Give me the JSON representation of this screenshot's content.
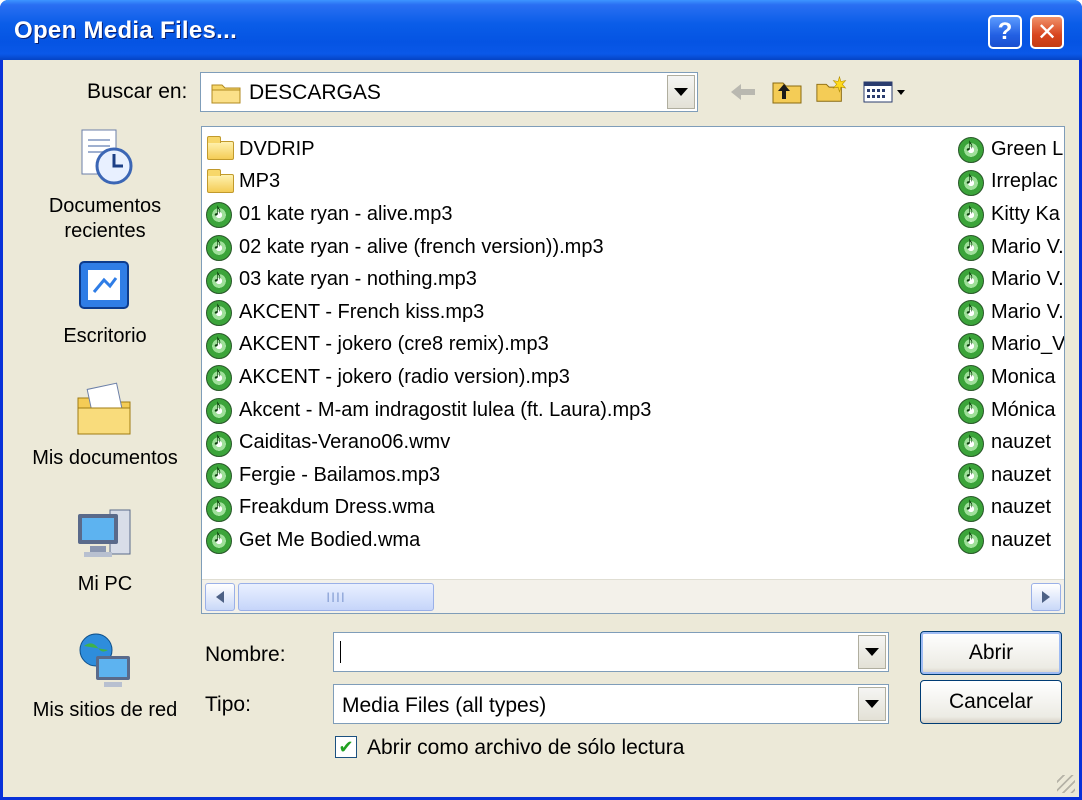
{
  "window": {
    "title": "Open Media Files...",
    "help_label": "?",
    "close_label": "✕"
  },
  "lookin": {
    "label": "Buscar en:",
    "value": "DESCARGAS"
  },
  "places": [
    {
      "label": "Documentos recientes",
      "icon": "recent-documents-icon"
    },
    {
      "label": "Escritorio",
      "icon": "desktop-icon"
    },
    {
      "label": "Mis documentos",
      "icon": "my-documents-icon"
    },
    {
      "label": "Mi PC",
      "icon": "my-computer-icon"
    },
    {
      "label": "Mis sitios de red",
      "icon": "network-places-icon"
    }
  ],
  "files_left": [
    {
      "name": "DVDRIP",
      "type": "folder"
    },
    {
      "name": "MP3",
      "type": "folder"
    },
    {
      "name": "01 kate ryan - alive.mp3",
      "type": "media"
    },
    {
      "name": "02 kate ryan - alive (french version)).mp3",
      "type": "media"
    },
    {
      "name": "03 kate ryan - nothing.mp3",
      "type": "media"
    },
    {
      "name": "AKCENT - French kiss.mp3",
      "type": "media"
    },
    {
      "name": "AKCENT - jokero (cre8 remix).mp3",
      "type": "media"
    },
    {
      "name": "AKCENT - jokero (radio version).mp3",
      "type": "media"
    },
    {
      "name": "Akcent - M-am indragostit lulea (ft. Laura).mp3",
      "type": "media"
    },
    {
      "name": "Caiditas-Verano06.wmv",
      "type": "media"
    },
    {
      "name": "Fergie - Bailamos.mp3",
      "type": "media"
    },
    {
      "name": "Freakdum Dress.wma",
      "type": "media"
    },
    {
      "name": "Get Me Bodied.wma",
      "type": "media"
    }
  ],
  "files_right": [
    {
      "name": "Green L",
      "type": "media"
    },
    {
      "name": "Irreplac",
      "type": "media"
    },
    {
      "name": "Kitty Ka",
      "type": "media"
    },
    {
      "name": "Mario V.",
      "type": "media"
    },
    {
      "name": "Mario V.",
      "type": "media"
    },
    {
      "name": "Mario V.",
      "type": "media"
    },
    {
      "name": "Mario_V",
      "type": "media"
    },
    {
      "name": "Monica",
      "type": "media"
    },
    {
      "name": "Mónica",
      "type": "media"
    },
    {
      "name": "nauzet",
      "type": "media"
    },
    {
      "name": "nauzet",
      "type": "media"
    },
    {
      "name": "nauzet",
      "type": "media"
    },
    {
      "name": "nauzet",
      "type": "media"
    }
  ],
  "scrollbar": {
    "thumb_grip": "IIII"
  },
  "filename": {
    "label": "Nombre:",
    "value": ""
  },
  "filetype": {
    "label": "Tipo:",
    "value": "Media Files (all types)"
  },
  "buttons": {
    "open": "Abrir",
    "cancel": "Cancelar"
  },
  "readonly": {
    "label": "Abrir como archivo de sólo lectura",
    "checked": true,
    "check_glyph": "✔"
  },
  "colors": {
    "titlebar": "#0554e3",
    "dialog_bg": "#ece9d8",
    "border": "#0831d9"
  }
}
